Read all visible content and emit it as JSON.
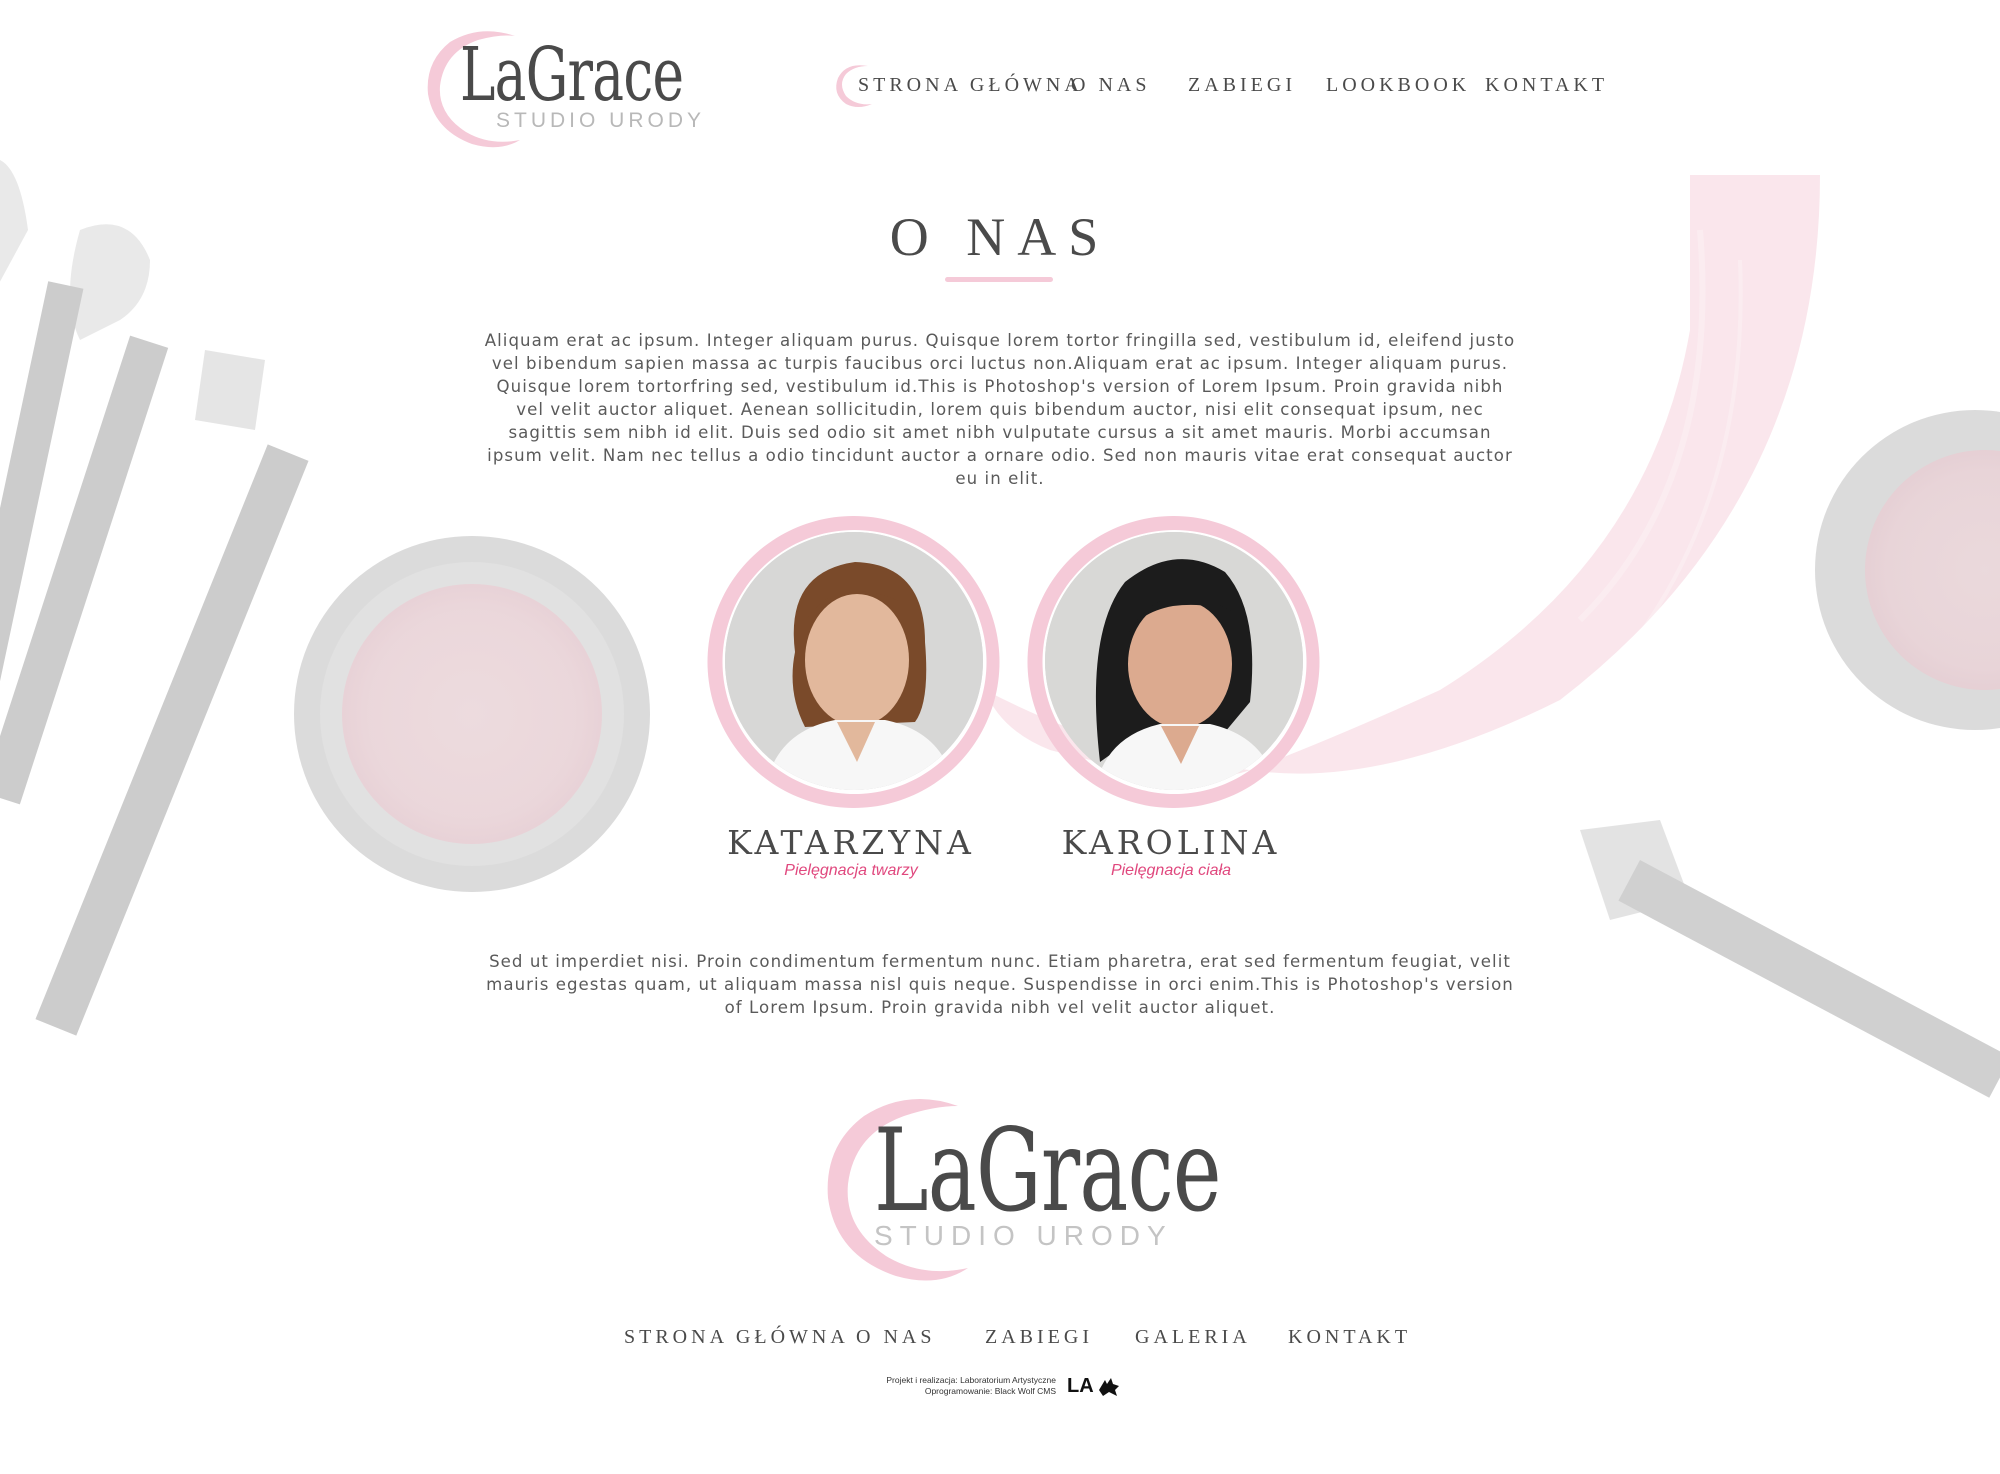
{
  "brand": {
    "name": "LaGrace",
    "tagline": "STUDIO URODY",
    "accent_color": "#f5cad8",
    "highlight_color": "#e0487e"
  },
  "nav": {
    "items": [
      {
        "label": "STRONA GŁÓWNA",
        "active": true
      },
      {
        "label": "O NAS",
        "active": false
      },
      {
        "label": "ZABIEGI",
        "active": false
      },
      {
        "label": "LOOKBOOK",
        "active": false
      },
      {
        "label": "KONTAKT",
        "active": false
      }
    ]
  },
  "about": {
    "title": "O NAS",
    "intro": "Aliquam erat ac ipsum. Integer aliquam purus. Quisque lorem tortor fringilla sed, vestibulum id, eleifend justo vel bibendum sapien massa ac turpis faucibus orci luctus non.Aliquam erat ac ipsum. Integer aliquam purus. Quisque lorem tortorfring sed, vestibulum id.This is Photoshop's version  of Lorem Ipsum. Proin gravida nibh vel velit auctor aliquet. Aenean sollicitudin, lorem quis bibendum auctor, nisi elit consequat ipsum, nec sagittis sem nibh id elit. Duis sed odio sit amet nibh vulputate cursus a sit amet mauris. Morbi accumsan ipsum velit. Nam nec tellus a odio tincidunt auctor a ornare odio. Sed non  mauris vitae erat consequat auctor eu in elit.",
    "outro": "Sed ut imperdiet nisi. Proin condimentum fermentum nunc. Etiam pharetra, erat sed fermentum feugiat, velit mauris egestas quam, ut aliquam massa nisl quis neque. Suspendisse in orci enim.This is Photoshop's version  of Lorem Ipsum. Proin gravida nibh vel velit auctor aliquet."
  },
  "team": [
    {
      "name": "KATARZYNA",
      "role": "Pielęgnacja twarzy",
      "hair_color": "#7a4a2a"
    },
    {
      "name": "KAROLINA",
      "role": "Pielęgnacja ciała",
      "hair_color": "#1c1c1c"
    }
  ],
  "footer": {
    "nav": [
      "STRONA GŁÓWNA",
      "O NAS",
      "ZABIEGI",
      "GALERIA",
      "KONTAKT"
    ],
    "credits_line1": "Projekt i realizacja: Laboratorium Artystyczne",
    "credits_line2": "Oprogramowanie: Black Wolf CMS",
    "credits_logo": "LA"
  }
}
